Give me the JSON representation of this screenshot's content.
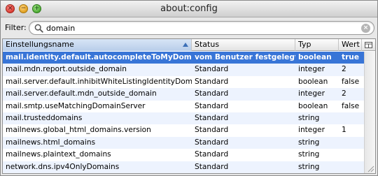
{
  "window": {
    "title": "about:config",
    "buttons": {
      "close": "×",
      "minimize": "−",
      "maximize": "+"
    }
  },
  "filter": {
    "label": "Filter:",
    "value": "domain",
    "placeholder": "",
    "clear_icon": "×"
  },
  "table": {
    "columns": [
      {
        "label": "Einstellungsname",
        "sorted": true
      },
      {
        "label": "Status"
      },
      {
        "label": "Typ"
      },
      {
        "label": "Wert"
      }
    ],
    "rows": [
      {
        "name": "mail.identity.default.autocompleteToMyDomain",
        "status": "vom Benutzer festgelegt",
        "type": "boolean",
        "value": "true",
        "selected": true
      },
      {
        "name": "mail.mdn.report.outside_domain",
        "status": "Standard",
        "type": "integer",
        "value": "2"
      },
      {
        "name": "mail.server.default.inhibitWhiteListingIdentityDomain",
        "status": "Standard",
        "type": "boolean",
        "value": "false"
      },
      {
        "name": "mail.server.default.mdn_outside_domain",
        "status": "Standard",
        "type": "integer",
        "value": "2"
      },
      {
        "name": "mail.smtp.useMatchingDomainServer",
        "status": "Standard",
        "type": "boolean",
        "value": "false"
      },
      {
        "name": "mail.trusteddomains",
        "status": "Standard",
        "type": "string",
        "value": ""
      },
      {
        "name": "mailnews.global_html_domains.version",
        "status": "Standard",
        "type": "integer",
        "value": "1"
      },
      {
        "name": "mailnews.html_domains",
        "status": "Standard",
        "type": "string",
        "value": ""
      },
      {
        "name": "mailnews.plaintext_domains",
        "status": "Standard",
        "type": "string",
        "value": ""
      },
      {
        "name": "network.dns.ipv4OnlyDomains",
        "status": "Standard",
        "type": "string",
        "value": ""
      }
    ]
  },
  "colors": {
    "selection": "#3875d7",
    "alternate_row": "#edf3fe",
    "sorted_header": "#b7cde9"
  }
}
